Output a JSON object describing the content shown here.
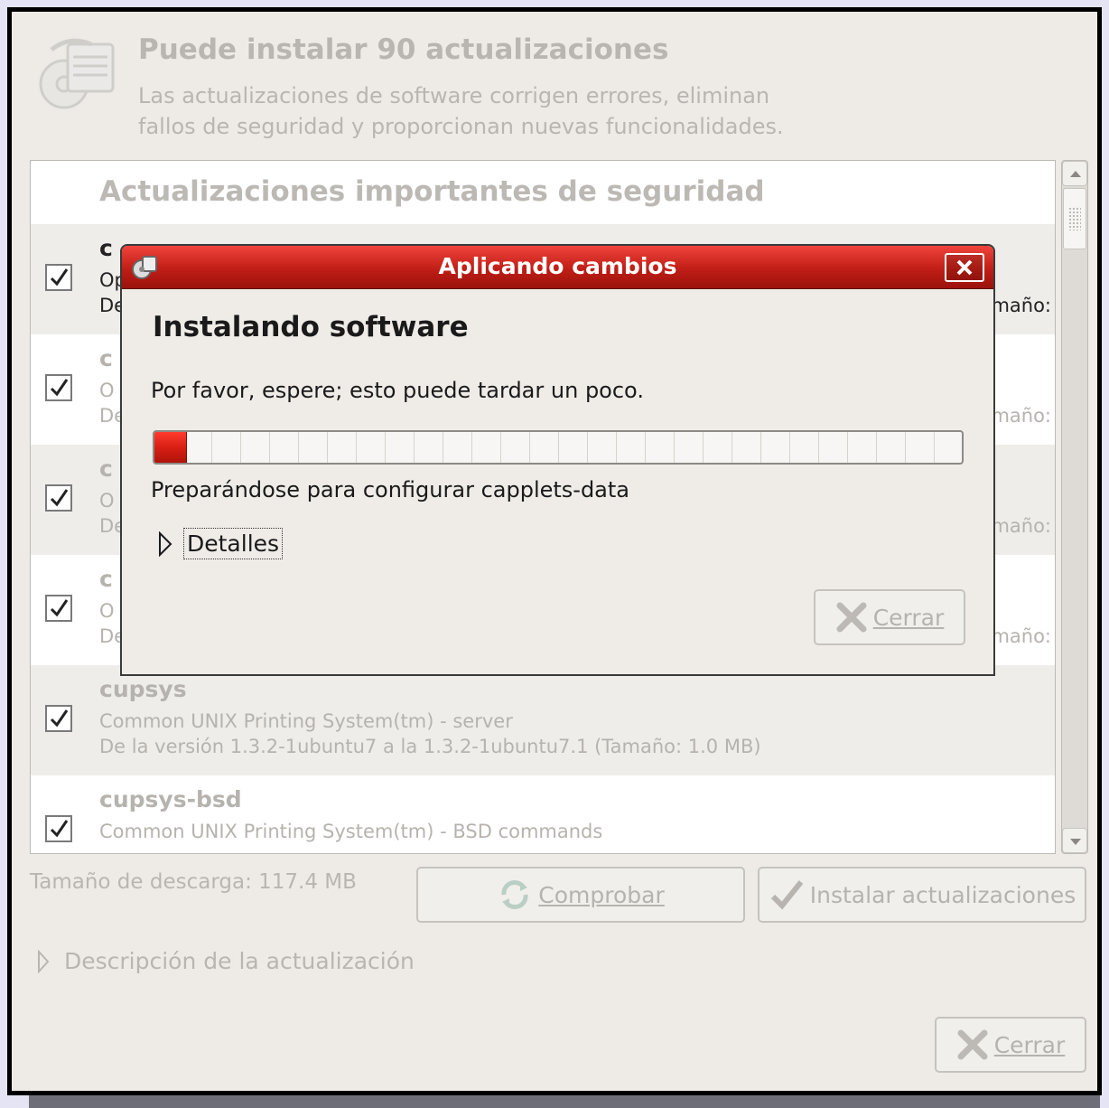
{
  "header": {
    "title": "Puede instalar 90 actualizaciones",
    "description_line1": "Las actualizaciones de software corrigen errores, eliminan",
    "description_line2": "fallos de seguridad y proporcionan nuevas funcionalidades."
  },
  "list": {
    "section_title": "Actualizaciones importantes de seguridad",
    "rows": [
      {
        "name": "c",
        "desc": "Op",
        "version": "De",
        "size_tail": "maño:",
        "checked": true
      },
      {
        "name": "c",
        "desc": "O",
        "version": "De",
        "size_tail": "maño:",
        "checked": true
      },
      {
        "name": "c",
        "desc": "O",
        "version": "De",
        "size_tail": "maño:",
        "checked": true
      },
      {
        "name": "c",
        "desc": "O",
        "version": "De",
        "size_tail": "maño:",
        "checked": true
      },
      {
        "name": "cupsys",
        "desc": "Common UNIX Printing System(tm) - server",
        "version": "De la versión 1.3.2-1ubuntu7 a la 1.3.2-1ubuntu7.1 (Tamaño: 1.0 MB)",
        "size_tail": "",
        "checked": true
      },
      {
        "name": "cupsys-bsd",
        "desc": "Common UNIX Printing System(tm) - BSD commands",
        "version": "",
        "size_tail": "",
        "checked": true
      }
    ]
  },
  "footer": {
    "download_size": "Tamaño de descarga: 117.4 MB",
    "check_button": "Comprobar",
    "install_button": "Instalar actualizaciones",
    "description_expander": "Descripción de la actualización",
    "close_button": "Cerrar"
  },
  "dialog": {
    "title": "Aplicando cambios",
    "heading": "Instalando software",
    "message": "Por favor, espere; esto puede tardar un poco.",
    "progress": 0.04,
    "status": "Preparándose para configurar capplets-data",
    "details_label": "Detalles",
    "close_button": "Cerrar"
  },
  "colors": {
    "titlebar_red": "#c01e16",
    "progress_red": "#d81f14",
    "disabled_text": "#b9b6b1"
  }
}
